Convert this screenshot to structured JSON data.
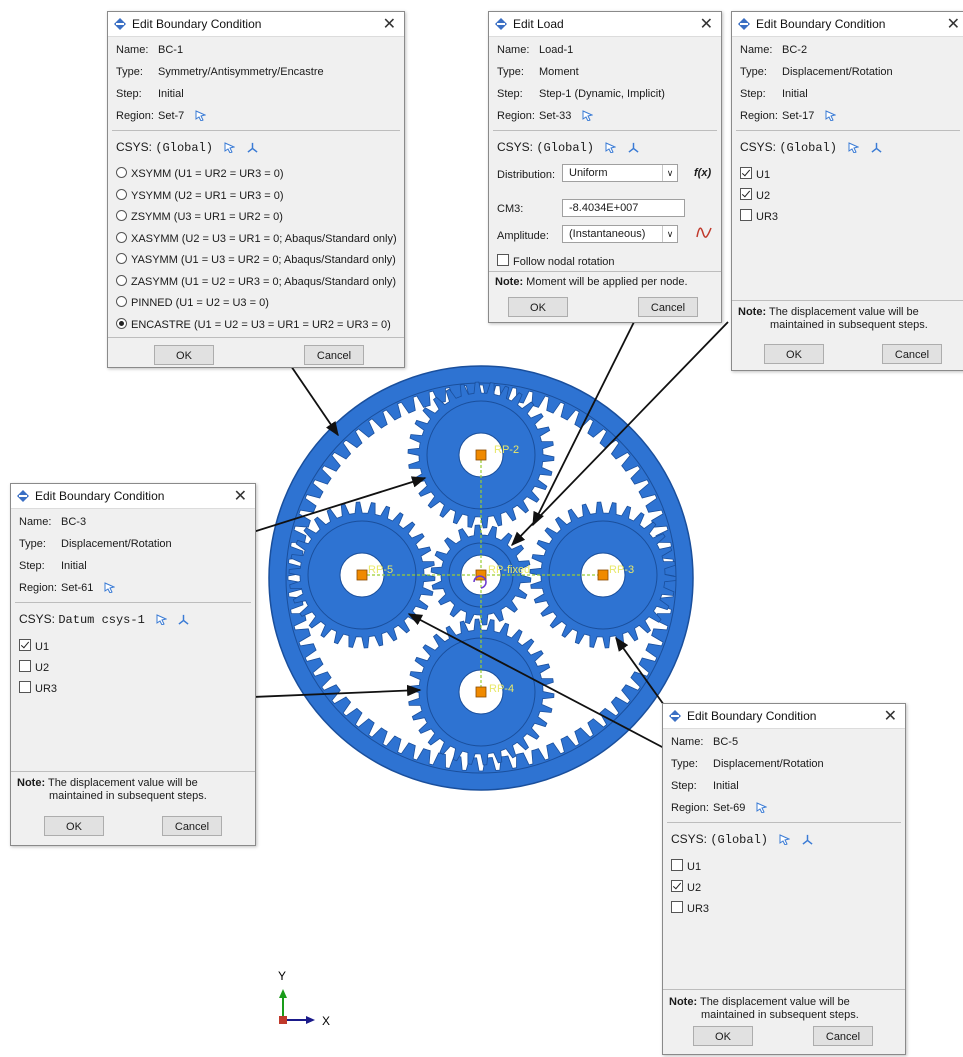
{
  "colors": {
    "gear_fill": "#2e73d2",
    "gear_dark": "#1a4f9c",
    "gear_gap": "#ffffff",
    "rp_marker": "#f08a00",
    "rp_label": "#e8e86a",
    "axis_y": "#1a9c1a",
    "axis_x": "#1a1a8a"
  },
  "dialogs": {
    "bc1": {
      "title": "Edit Boundary Condition",
      "name_label": "Name:",
      "name": "BC-1",
      "type_label": "Type:",
      "type": "Symmetry/Antisymmetry/Encastre",
      "step_label": "Step:",
      "step": "Initial",
      "region_label": "Region:",
      "region": "Set-7",
      "csys_label": "CSYS:",
      "csys": "(Global)",
      "options": [
        {
          "label": "XSYMM (U1 = UR2 = UR3 = 0)",
          "selected": false
        },
        {
          "label": "YSYMM (U2 = UR1 = UR3 = 0)",
          "selected": false
        },
        {
          "label": "ZSYMM (U3 = UR1 = UR2 = 0)",
          "selected": false
        },
        {
          "label": "XASYMM (U2 = U3 = UR1 = 0; Abaqus/Standard only)",
          "selected": false
        },
        {
          "label": "YASYMM (U1 = U3 = UR2 = 0; Abaqus/Standard only)",
          "selected": false
        },
        {
          "label": "ZASYMM (U1 = U2 = UR3 = 0; Abaqus/Standard only)",
          "selected": false
        },
        {
          "label": "PINNED (U1 = U2 = U3 = 0)",
          "selected": false
        },
        {
          "label": "ENCASTRE (U1 = U2 = U3 = UR1 = UR2 = UR3 = 0)",
          "selected": true
        }
      ],
      "ok": "OK",
      "cancel": "Cancel"
    },
    "load1": {
      "title": "Edit Load",
      "name_label": "Name:",
      "name": "Load-1",
      "type_label": "Type:",
      "type": "Moment",
      "step_label": "Step:",
      "step": "Step-1 (Dynamic, Implicit)",
      "region_label": "Region:",
      "region": "Set-33",
      "csys_label": "CSYS:",
      "csys": "(Global)",
      "distribution_label": "Distribution:",
      "distribution": "Uniform",
      "fx": "f(x)",
      "cm3_label": "CM3:",
      "cm3": "-8.4034E+007",
      "amplitude_label": "Amplitude:",
      "amplitude": "(Instantaneous)",
      "follow_label": "Follow nodal rotation",
      "note_label": "Note:",
      "note": "Moment will be applied per node.",
      "ok": "OK",
      "cancel": "Cancel"
    },
    "bc2": {
      "title": "Edit Boundary Condition",
      "name_label": "Name:",
      "name": "BC-2",
      "type_label": "Type:",
      "type": "Displacement/Rotation",
      "step_label": "Step:",
      "step": "Initial",
      "region_label": "Region:",
      "region": "Set-17",
      "csys_label": "CSYS:",
      "csys": "(Global)",
      "dofs": [
        {
          "label": "U1",
          "checked": true
        },
        {
          "label": "U2",
          "checked": true
        },
        {
          "label": "UR3",
          "checked": false
        }
      ],
      "note_label": "Note:",
      "note_line1": "The displacement value will be",
      "note_line2": "maintained in subsequent steps.",
      "ok": "OK",
      "cancel": "Cancel"
    },
    "bc3": {
      "title": "Edit Boundary Condition",
      "name_label": "Name:",
      "name": "BC-3",
      "type_label": "Type:",
      "type": "Displacement/Rotation",
      "step_label": "Step:",
      "step": "Initial",
      "region_label": "Region:",
      "region": "Set-61",
      "csys_label": "CSYS:",
      "csys": "Datum csys-1",
      "dofs": [
        {
          "label": "U1",
          "checked": true
        },
        {
          "label": "U2",
          "checked": false
        },
        {
          "label": "UR3",
          "checked": false
        }
      ],
      "note_label": "Note:",
      "note_line1": "The displacement value will be",
      "note_line2": "maintained in subsequent steps.",
      "ok": "OK",
      "cancel": "Cancel"
    },
    "bc5": {
      "title": "Edit Boundary Condition",
      "name_label": "Name:",
      "name": "BC-5",
      "type_label": "Type:",
      "type": "Displacement/Rotation",
      "step_label": "Step:",
      "step": "Initial",
      "region_label": "Region:",
      "region": "Set-69",
      "csys_label": "CSYS:",
      "csys": "(Global)",
      "dofs": [
        {
          "label": "U1",
          "checked": false
        },
        {
          "label": "U2",
          "checked": true
        },
        {
          "label": "UR3",
          "checked": false
        }
      ],
      "note_label": "Note:",
      "note_line1": "The displacement value will be",
      "note_line2": "maintained in subsequent steps.",
      "ok": "OK",
      "cancel": "Cancel"
    }
  },
  "viewport": {
    "rp_labels": [
      "RP-2",
      "RP-5",
      "RP-3",
      "RP-4",
      "RP-fixed"
    ],
    "axis_y_label": "Y",
    "axis_x_label": "X"
  }
}
